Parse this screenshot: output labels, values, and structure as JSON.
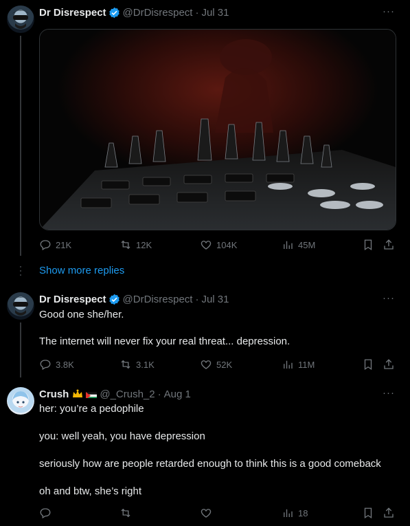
{
  "tweets": [
    {
      "name": "Dr Disrespect",
      "handle": "@DrDisrespect",
      "date": "Jul 31",
      "stats": {
        "replies": "21K",
        "retweets": "12K",
        "likes": "104K",
        "views": "45M"
      }
    },
    {
      "name": "Dr Disrespect",
      "handle": "@DrDisrespect",
      "date": "Jul 31",
      "lines": [
        "Good one she/her.",
        "The internet will never fix your real threat... depression."
      ],
      "stats": {
        "replies": "3.8K",
        "retweets": "3.1K",
        "likes": "52K",
        "views": "11M"
      }
    },
    {
      "name": "Crush",
      "handle": "@_Crush_2",
      "date": "Aug 1",
      "lines": [
        "her: you’re a pedophile",
        "you: well yeah, you have depression",
        "seriously how are people retarded enough to think this is a good comeback",
        "oh and btw, she’s right"
      ],
      "stats": {
        "replies": "",
        "retweets": "",
        "likes": "",
        "views": "18"
      }
    }
  ],
  "show_more": "Show more replies",
  "more_label": "···",
  "separator": "·",
  "icons": [
    "reply-icon",
    "retweet-icon",
    "like-icon",
    "views-icon",
    "bookmark-icon",
    "share-icon",
    "verified-badge-icon",
    "more-icon"
  ],
  "colors": {
    "link": "#1d9bf0",
    "muted": "#71767b",
    "text": "#e7e9ea",
    "background": "#000000"
  }
}
